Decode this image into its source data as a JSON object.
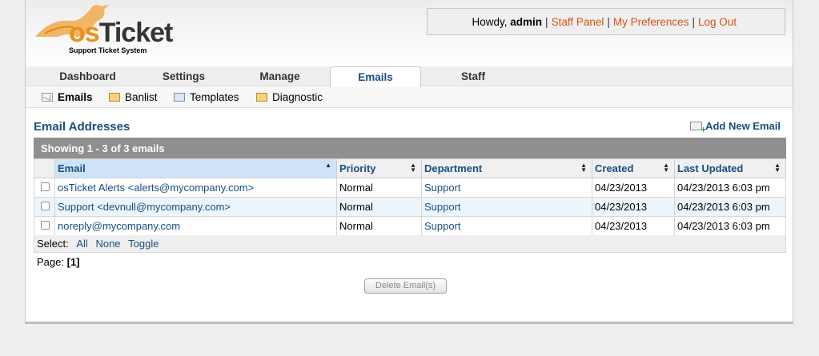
{
  "logo": {
    "brand_os": "os",
    "brand_ticket": "Ticket",
    "subtitle": "Support Ticket System"
  },
  "userbar": {
    "greeting": "Howdy,",
    "username": "admin",
    "links": [
      "Staff Panel",
      "My Preferences",
      "Log Out"
    ]
  },
  "tabs": [
    {
      "label": "Dashboard",
      "active": false
    },
    {
      "label": "Settings",
      "active": false
    },
    {
      "label": "Manage",
      "active": false
    },
    {
      "label": "Emails",
      "active": true
    },
    {
      "label": "Staff",
      "active": false
    }
  ],
  "subnav": [
    {
      "label": "Emails",
      "icon": "email-icon",
      "active": true
    },
    {
      "label": "Banlist",
      "icon": "banlist-icon",
      "active": false
    },
    {
      "label": "Templates",
      "icon": "templates-icon",
      "active": false
    },
    {
      "label": "Diagnostic",
      "icon": "diagnostic-icon",
      "active": false
    }
  ],
  "page": {
    "title": "Email Addresses",
    "add_new": "Add New Email",
    "showing": "Showing  1 - 3 of 3 emails"
  },
  "table": {
    "columns": [
      "Email",
      "Priority",
      "Department",
      "Created",
      "Last Updated"
    ],
    "rows": [
      {
        "email": "osTicket Alerts <alerts@mycompany.com>",
        "priority": "Normal",
        "department": "Support",
        "created": "04/23/2013",
        "updated": "04/23/2013 6:03 pm"
      },
      {
        "email": "Support <devnull@mycompany.com>",
        "priority": "Normal",
        "department": "Support",
        "created": "04/23/2013",
        "updated": "04/23/2013 6:03 pm"
      },
      {
        "email": "noreply@mycompany.com",
        "priority": "Normal",
        "department": "Support",
        "created": "04/23/2013",
        "updated": "04/23/2013 6:03 pm"
      }
    ]
  },
  "select": {
    "label": "Select:",
    "all": "All",
    "none": "None",
    "toggle": "Toggle"
  },
  "pager": {
    "label": "Page:",
    "current": "[1]"
  },
  "actions": {
    "delete": "Delete Email(s)"
  },
  "colors": {
    "link": "#184e81",
    "accent": "#d25417",
    "header_bar": "#8f8f8f"
  }
}
